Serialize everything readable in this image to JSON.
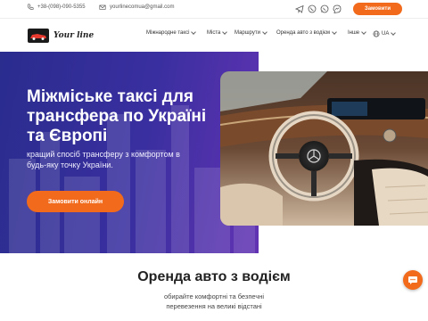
{
  "topbar": {
    "phone": "+38-(098)-090-5355",
    "email": "yourlinecomua@gmail.com",
    "order_button": "Замовити",
    "social": [
      "telegram-icon",
      "viber-icon",
      "whatsapp-icon",
      "messenger-icon"
    ]
  },
  "nav": {
    "logo_text": "Your line",
    "items": [
      "Міжнародне таксі",
      "Міста",
      "Маршрути",
      "Оренда авто з водієм",
      "Інше"
    ],
    "language": "UA"
  },
  "hero": {
    "title": "Міжміське таксі для трансфера по Україні та Європі",
    "subtitle": "кращий спосіб трансферу з комфортом в будь-яку точку України.",
    "cta": "Замовити онлайн"
  },
  "section": {
    "title": "Оренда авто з водієм",
    "subtitle_line1": "обирайте комфортні та безпечні",
    "subtitle_line2": "перевезення на великі відстані"
  },
  "colors": {
    "accent": "#f26a1b",
    "hero_start": "#2a2c8e",
    "hero_end": "#6b34b8"
  }
}
